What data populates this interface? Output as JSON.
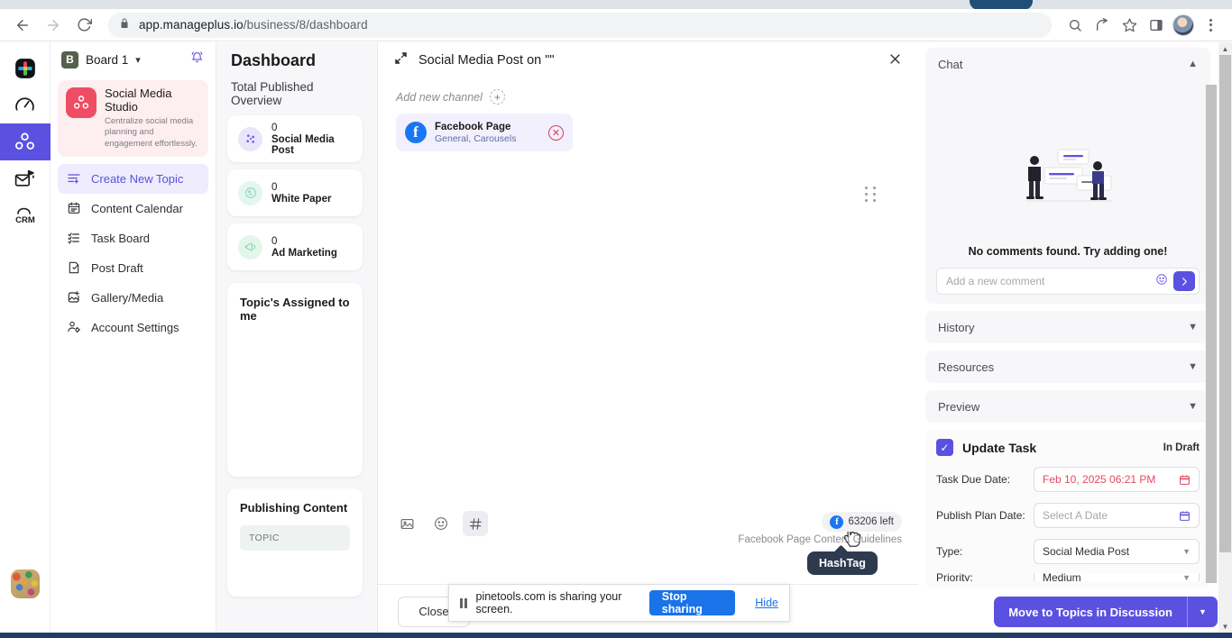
{
  "browser": {
    "url_bold": "app.manageplus.io",
    "url_rest": "/business/8/dashboard",
    "back_icon": "back-arrow-icon",
    "forward_icon": "forward-arrow-icon",
    "reload_icon": "reload-icon",
    "lock_icon": "lock-icon",
    "search_icon": "search-icon",
    "share_icon": "share-icon",
    "bookmark_icon": "star-icon",
    "sidepanel_icon": "side-panel-icon",
    "menu_icon": "kebab-menu-icon"
  },
  "rail": {
    "items": [
      {
        "name": "apps-grid-icon",
        "label": "Apps"
      },
      {
        "name": "speedometer-icon",
        "label": "Dashboard"
      },
      {
        "name": "social-studio-icon",
        "label": "Social Media Studio"
      },
      {
        "name": "campaign-mail-icon",
        "label": "Campaigns"
      },
      {
        "name": "crm-icon",
        "label": "CRM"
      }
    ],
    "bottom_avatar": "user-avatar"
  },
  "leftnav": {
    "board_initial": "B",
    "board_name": "Board 1",
    "bell_icon": "notification-bell-icon",
    "studio": {
      "title": "Social Media Studio",
      "subtitle": "Centralize social media planning and engagement effortlessly."
    },
    "items": [
      {
        "label": "Create New Topic",
        "icon": "create-topic-icon",
        "active": true
      },
      {
        "label": "Content Calendar",
        "icon": "calendar-icon",
        "active": false
      },
      {
        "label": "Task Board",
        "icon": "task-list-icon",
        "active": false
      },
      {
        "label": "Post Draft",
        "icon": "draft-edit-icon",
        "active": false
      },
      {
        "label": "Gallery/Media",
        "icon": "image-add-icon",
        "active": false
      },
      {
        "label": "Account Settings",
        "icon": "account-settings-icon",
        "active": false
      }
    ]
  },
  "dashboard": {
    "title": "Dashboard",
    "overview_label": "Total Published Overview",
    "stats": [
      {
        "count": "0",
        "label": "Social Media Post",
        "icon": "network-nodes-icon",
        "bg": "#e9e6fb",
        "fg": "#6b5ce7"
      },
      {
        "count": "0",
        "label": "White Paper",
        "icon": "whitepaper-icon",
        "bg": "#e4f6f0",
        "fg": "#39b08c"
      },
      {
        "count": "0",
        "label": "Ad Marketing",
        "icon": "megaphone-icon",
        "bg": "#e4f6ea",
        "fg": "#3fae6a"
      }
    ],
    "assigned_title": "Topic's Assigned to me",
    "publishing_title": "Publishing Content",
    "publishing_chip": "TOPIC"
  },
  "modal": {
    "expand_icon": "expand-icon",
    "title": "Social Media Post on \"\"",
    "close_icon": "close-icon",
    "add_channel_label": "Add new channel",
    "add_channel_icon": "plus-icon",
    "channel": {
      "name": "Facebook Page",
      "detail": "General, Carousels",
      "brand_icon": "facebook-icon",
      "remove_icon": "remove-circle-icon"
    },
    "drag_handle_icon": "drag-handle-icon",
    "toolbar": [
      {
        "icon": "image-icon",
        "label": "Image",
        "hover": false
      },
      {
        "icon": "emoji-icon",
        "label": "Emoji",
        "hover": false
      },
      {
        "icon": "hashtag-icon",
        "label": "HashTag",
        "hover": true
      }
    ],
    "tooltip": "HashTag",
    "char_count": "63206 left",
    "char_count_icon": "facebook-icon",
    "guidelines": "Facebook Page Content Guidelines",
    "close_button": "Close"
  },
  "right": {
    "chat": {
      "title": "Chat",
      "collapse_icon": "chevron-up-icon",
      "empty_text": "No comments found. Try adding one!",
      "comment_placeholder": "Add a new comment",
      "comment_value": "",
      "emoji_icon": "emoji-icon",
      "send_icon": "send-icon"
    },
    "sections": [
      {
        "title": "History",
        "icon": "chevron-down-icon"
      },
      {
        "title": "Resources",
        "icon": "chevron-down-icon"
      },
      {
        "title": "Preview",
        "icon": "chevron-down-icon"
      }
    ],
    "update": {
      "checkbox_icon": "checkmark-icon",
      "title": "Update Task",
      "status": "In Draft",
      "fields": [
        {
          "label": "Task Due Date:",
          "value": "Feb 10, 2025 06:21 PM",
          "placeholder": "",
          "icon": "calendar-icon",
          "red": true
        },
        {
          "label": "Publish Plan Date:",
          "value": "",
          "placeholder": "Select A Date",
          "icon": "calendar-icon",
          "red": false
        },
        {
          "label": "Type:",
          "value": "Social Media Post",
          "placeholder": "",
          "icon": "chevron-down-icon",
          "red": false
        }
      ]
    },
    "action": {
      "label": "Move to Topics in Discussion",
      "split_icon": "chevron-down-icon"
    }
  },
  "sharebar": {
    "pause_icon": "pause-icon",
    "message": "pinetools.com is sharing your screen.",
    "stop_label": "Stop sharing",
    "hide_label": "Hide"
  },
  "colors": {
    "accent": "#5b51e0",
    "brand_pink": "#ee4d64",
    "facebook": "#1877f2",
    "danger": "#e4495f",
    "chrome_blue": "#1a73e8"
  }
}
